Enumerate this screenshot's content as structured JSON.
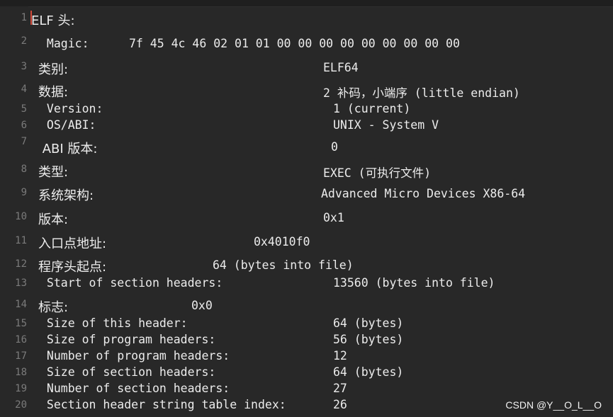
{
  "watermark": "CSDN @Y__O_L__O",
  "lines": [
    {
      "num": "1",
      "label": "ELF 头:",
      "value": ""
    },
    {
      "num": "2",
      "label": " Magic:",
      "value": "7f 45 4c 46 02 01 01 00 00 00 00 00 00 00 00 00"
    },
    {
      "num": "3",
      "label": "类别:",
      "value": "ELF64"
    },
    {
      "num": "4",
      "label": "数据:",
      "value": "2 补码，小端序 (little endian)"
    },
    {
      "num": "5",
      "label": " Version:",
      "value": "1 (current)"
    },
    {
      "num": "6",
      "label": " OS/ABI:",
      "value": "UNIX - System V"
    },
    {
      "num": "7",
      "label": " ABI 版本:",
      "value": "0"
    },
    {
      "num": "8",
      "label": "类型:",
      "value": "EXEC (可执行文件)"
    },
    {
      "num": "9",
      "label": "系统架构:",
      "value": "Advanced Micro Devices X86-64"
    },
    {
      "num": "10",
      "label": "版本:",
      "value": "0x1"
    },
    {
      "num": "11",
      "label": "入口点地址:",
      "value": "0x4010f0"
    },
    {
      "num": "12",
      "label": "程序头起点:",
      "value": "64 (bytes into file)"
    },
    {
      "num": "13",
      "label": " Start of section headers:",
      "value": "13560 (bytes into file)"
    },
    {
      "num": "14",
      "label": "标志:",
      "value": "0x0"
    },
    {
      "num": "15",
      "label": " Size of this header:",
      "value": "64 (bytes)"
    },
    {
      "num": "16",
      "label": " Size of program headers:",
      "value": "56 (bytes)"
    },
    {
      "num": "17",
      "label": " Number of program headers:",
      "value": "12"
    },
    {
      "num": "18",
      "label": " Size of section headers:",
      "value": "64 (bytes)"
    },
    {
      "num": "19",
      "label": " Number of section headers:",
      "value": "27"
    },
    {
      "num": "20",
      "label": " Section header string table index:",
      "value": "26"
    }
  ]
}
